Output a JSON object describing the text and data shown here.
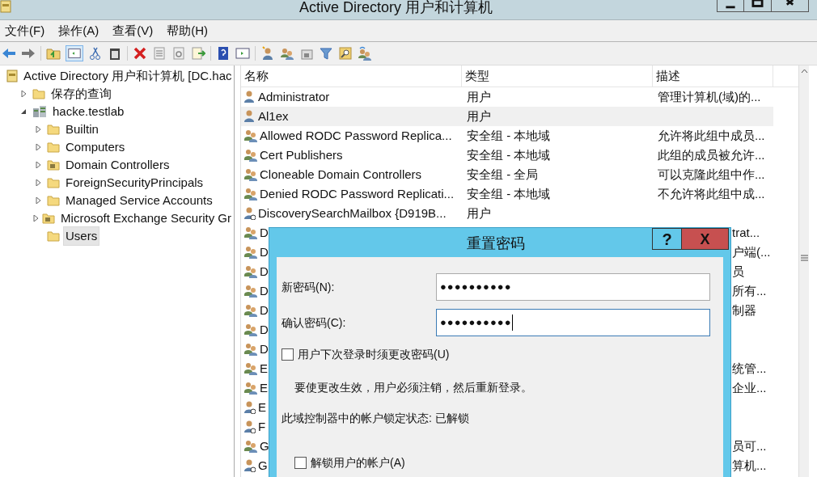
{
  "window": {
    "title": "Active Directory 用户和计算机"
  },
  "menu": [
    "文件(F)",
    "操作(A)",
    "查看(V)",
    "帮助(H)"
  ],
  "tree": {
    "label": "Active Directory 用户和计算机 [DC.hac",
    "kind": "root",
    "children": [
      {
        "label": "保存的查询",
        "kind": "folder",
        "expanded": false,
        "selected": false
      },
      {
        "label": "hacke.testlab",
        "kind": "domain",
        "expanded": true,
        "selected": false,
        "children": [
          {
            "label": "Builtin",
            "kind": "folder",
            "expanded": false,
            "selected": false
          },
          {
            "label": "Computers",
            "kind": "folder",
            "expanded": false,
            "selected": false
          },
          {
            "label": "Domain Controllers",
            "kind": "ou",
            "expanded": false,
            "selected": false
          },
          {
            "label": "ForeignSecurityPrincipals",
            "kind": "folder",
            "expanded": false,
            "selected": false
          },
          {
            "label": "Managed Service Accounts",
            "kind": "folder",
            "expanded": false,
            "selected": false
          },
          {
            "label": "Microsoft Exchange Security Gr",
            "kind": "ou",
            "expanded": false,
            "selected": false
          },
          {
            "label": "Users",
            "kind": "folder",
            "selected": true
          }
        ]
      }
    ]
  },
  "table": {
    "columns": [
      "名称",
      "类型",
      "描述"
    ],
    "rows": [
      {
        "kind": "user",
        "name": "Administrator",
        "type": "用户",
        "description": "管理计算机(域)的...",
        "selected": false
      },
      {
        "kind": "user",
        "name": "Al1ex",
        "type": "用户",
        "description": "",
        "selected": true
      },
      {
        "kind": "group",
        "name": "Allowed RODC Password Replica...",
        "type": "安全组 - 本地域",
        "description": "允许将此组中成员...",
        "selected": false
      },
      {
        "kind": "group",
        "name": "Cert Publishers",
        "type": "安全组 - 本地域",
        "description": "此组的成员被允许...",
        "selected": false
      },
      {
        "kind": "group",
        "name": "Cloneable Domain Controllers",
        "type": "安全组 - 全局",
        "description": "可以克隆此组中作...",
        "selected": false
      },
      {
        "kind": "group",
        "name": "Denied RODC Password Replicati...",
        "type": "安全组 - 本地域",
        "description": "不允许将此组中成...",
        "selected": false
      },
      {
        "kind": "mailuser",
        "name": "DiscoverySearchMailbox {D919B...",
        "type": "用户",
        "description": "",
        "selected": false
      },
      {
        "kind": "group",
        "name": "D",
        "description": "trat...",
        "selected": false
      },
      {
        "kind": "group",
        "name": "D",
        "description": "户端(...",
        "selected": false
      },
      {
        "kind": "group",
        "name": "D",
        "description": "员",
        "selected": false
      },
      {
        "kind": "group",
        "name": "D",
        "description": "所有...",
        "selected": false
      },
      {
        "kind": "group",
        "name": "D",
        "description": "制器",
        "selected": false
      },
      {
        "kind": "group",
        "name": "D",
        "description": "",
        "selected": false
      },
      {
        "kind": "group",
        "name": "D",
        "description": "",
        "selected": false
      },
      {
        "kind": "group",
        "name": "E",
        "description": "统管...",
        "selected": false
      },
      {
        "kind": "group",
        "name": "E",
        "description": "企业...",
        "selected": false
      },
      {
        "kind": "mailuser",
        "name": "E",
        "description": "",
        "selected": false
      },
      {
        "kind": "mailuser",
        "name": "F",
        "description": "",
        "selected": false
      },
      {
        "kind": "group",
        "name": "G",
        "description": "员可...",
        "selected": false
      },
      {
        "kind": "mailuser",
        "name": "G",
        "description": "算机...",
        "selected": false
      }
    ]
  },
  "dialog": {
    "title": "重置密码",
    "help_button": "?",
    "close_button": "X",
    "fields": [
      {
        "label": "新密码(N):",
        "value": "●●●●●●●●●●",
        "focused": false
      },
      {
        "label": "确认密码(C):",
        "value": "●●●●●●●●●●",
        "focused": true
      }
    ],
    "must_change": {
      "label": "用户下次登录时须更改密码(U)",
      "checked": false
    },
    "note": "要使更改生效，用户必须注销，然后重新登录。",
    "lock_status": "此域控制器中的帐户锁定状态: 已解锁",
    "unlock": {
      "label": "解锁用户的帐户(A)",
      "checked": false
    }
  }
}
